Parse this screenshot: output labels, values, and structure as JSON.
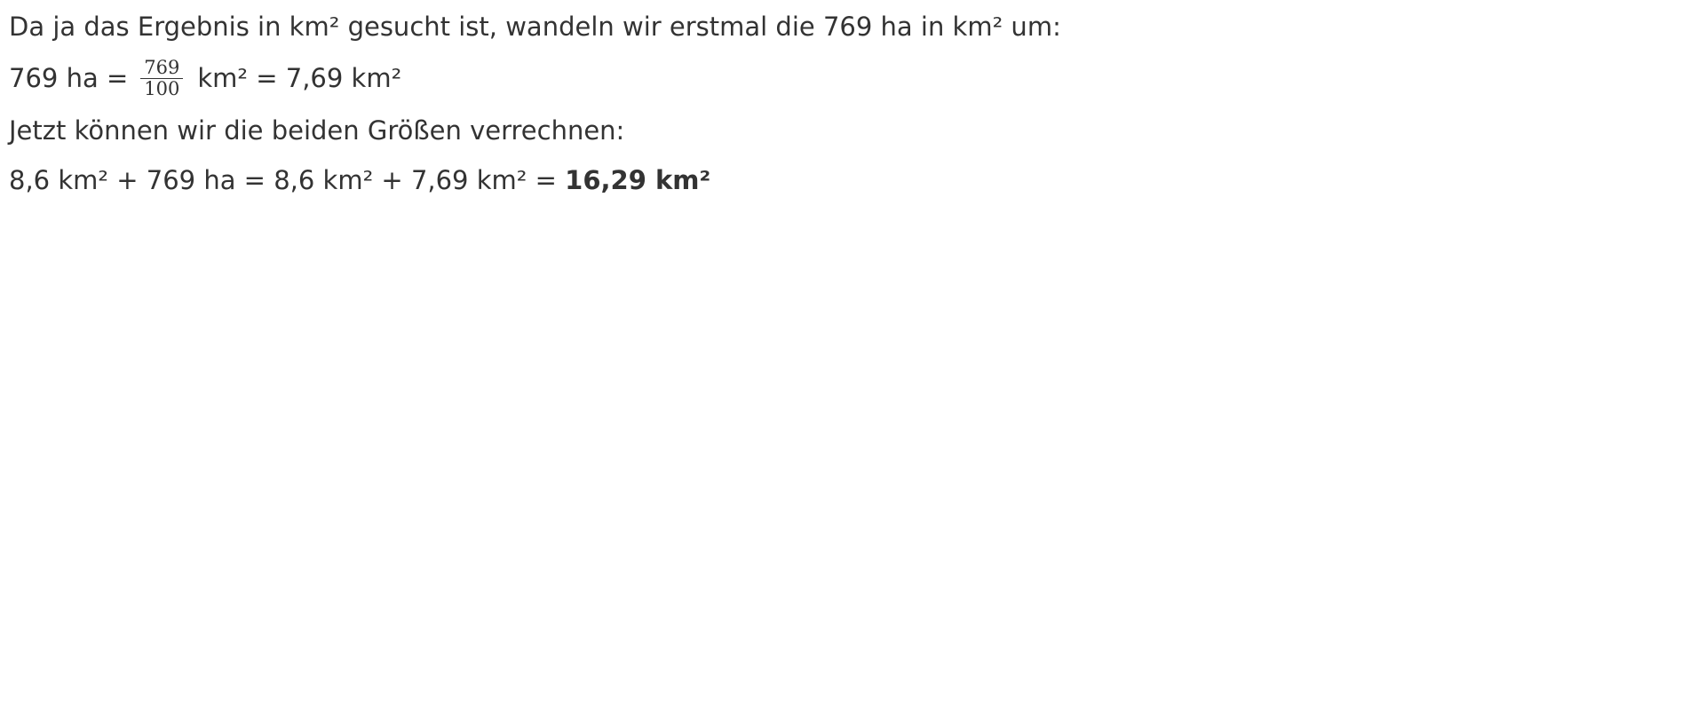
{
  "line1": "Da ja das Ergebnis in km² gesucht ist, wandeln wir erstmal die 769 ha in km² um:",
  "line2": {
    "left": "769 ha =",
    "numerator": "769",
    "denominator": "100",
    "right": "km² = 7,69 km²"
  },
  "line3": "Jetzt können wir die beiden Größen verrechnen:",
  "line4": {
    "text": "8,6 km² + 769 ha = 8,6 km² + 7,69 km² =",
    "result": "16,29 km²"
  }
}
